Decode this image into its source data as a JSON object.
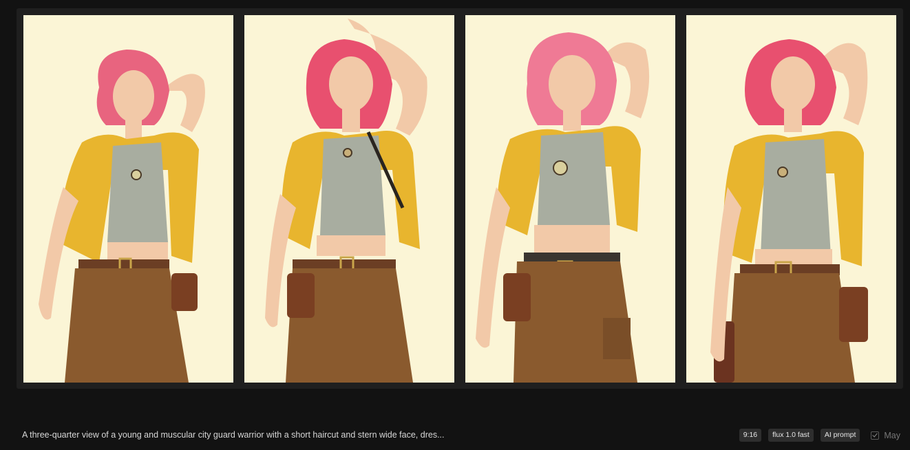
{
  "gallery": {
    "images": [
      {
        "name": "generated-image-1",
        "alt": "Pink-haired character in yellow jacket, variant 1"
      },
      {
        "name": "generated-image-2",
        "alt": "Pink-haired character in yellow jacket, variant 2"
      },
      {
        "name": "generated-image-3",
        "alt": "Pink-haired character in yellow jacket, variant 3"
      },
      {
        "name": "generated-image-4",
        "alt": "Pink-haired character in yellow jacket, variant 4"
      }
    ]
  },
  "footer": {
    "prompt": "A three-quarter view of a young and muscular city guard warrior with a short haircut and stern wide face, dres...",
    "tags": {
      "aspect_ratio": "9:16",
      "model": "flux 1.0 fast",
      "ai_prompt": "AI prompt"
    },
    "public_label": "May"
  },
  "colors": {
    "background": "#121212",
    "card": "#1f1f1f",
    "image_bg": "#fbf5d6",
    "hair": "#e8647f",
    "jacket": "#e8b52e",
    "shirt": "#a8ada0",
    "pants": "#8a5a2e",
    "skin": "#f2c9a8"
  }
}
